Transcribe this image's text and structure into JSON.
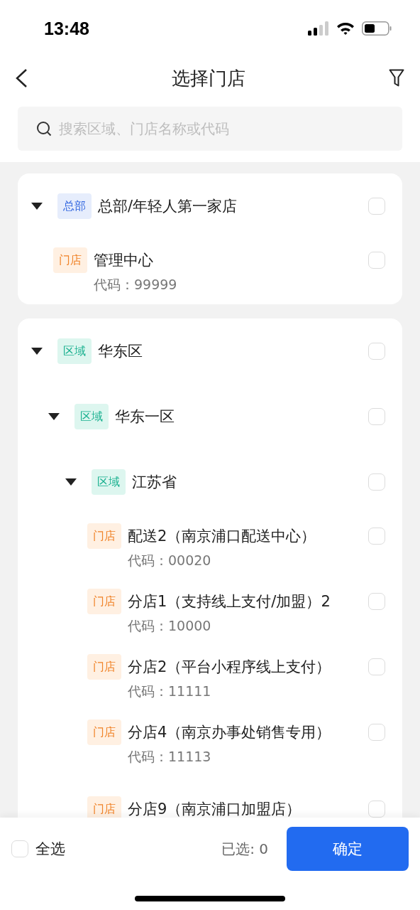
{
  "status_bar": {
    "time": "13:48"
  },
  "nav": {
    "title": "选择门店"
  },
  "search": {
    "placeholder": "搜索区域、门店名称或代码"
  },
  "cards": [
    {
      "nodes": [
        {
          "kind": "hq",
          "tag": "总部",
          "name": "总部/年轻人第一家店",
          "expanded": true,
          "checked": false,
          "children": [
            {
              "kind": "store",
              "tag": "门店",
              "name": "管理中心",
              "code": "代码：99999",
              "checked": false
            }
          ]
        }
      ]
    },
    {
      "nodes": [
        {
          "kind": "region",
          "tag": "区域",
          "name": "华东区",
          "expanded": true,
          "checked": false,
          "children": [
            {
              "kind": "region",
              "tag": "区域",
              "name": "华东一区",
              "expanded": true,
              "checked": false,
              "children": [
                {
                  "kind": "region",
                  "tag": "区域",
                  "name": "江苏省",
                  "expanded": true,
                  "checked": false,
                  "children": [
                    {
                      "kind": "store",
                      "tag": "门店",
                      "name": "配送2（南京浦口配送中心）",
                      "code": "代码：00020",
                      "checked": false
                    },
                    {
                      "kind": "store",
                      "tag": "门店",
                      "name": "分店1（支持线上支付/加盟）2",
                      "code": "代码：10000",
                      "checked": false
                    },
                    {
                      "kind": "store",
                      "tag": "门店",
                      "name": "分店2（平台小程序线上支付）",
                      "code": "代码：11111",
                      "checked": false
                    },
                    {
                      "kind": "store",
                      "tag": "门店",
                      "name": "分店4（南京办事处销售专用）",
                      "code": "代码：11113",
                      "checked": false
                    },
                    {
                      "kind": "store",
                      "tag": "门店",
                      "name": "分店9（南京浦口加盟店）",
                      "checked": false
                    }
                  ]
                }
              ]
            }
          ]
        }
      ]
    }
  ],
  "footer": {
    "select_all": {
      "label": "全选",
      "checked": false
    },
    "selected_count": "已选: 0",
    "confirm": "确定"
  }
}
